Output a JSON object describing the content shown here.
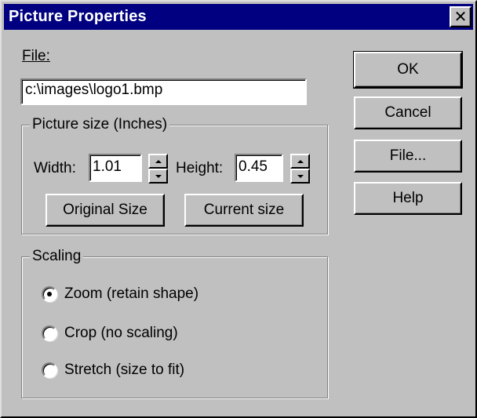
{
  "dialog": {
    "title": "Picture Properties",
    "close_glyph": "✕",
    "file_label": "File:",
    "file_path": "c:\\images\\logo1.bmp"
  },
  "size_group": {
    "title": "Picture size (Inches)",
    "width_label": "Width:",
    "width_value": "1.01",
    "height_label": "Height:",
    "height_value": "0.45",
    "original_size_button": "Original Size",
    "current_size_button": "Current size"
  },
  "scaling_group": {
    "title": "Scaling",
    "options": [
      {
        "label": "Zoom (retain shape)",
        "selected": true
      },
      {
        "label": "Crop (no scaling)",
        "selected": false
      },
      {
        "label": "Stretch (size to fit)",
        "selected": false
      }
    ]
  },
  "buttons": {
    "ok": "OK",
    "cancel": "Cancel",
    "file": "File...",
    "help": "Help"
  }
}
